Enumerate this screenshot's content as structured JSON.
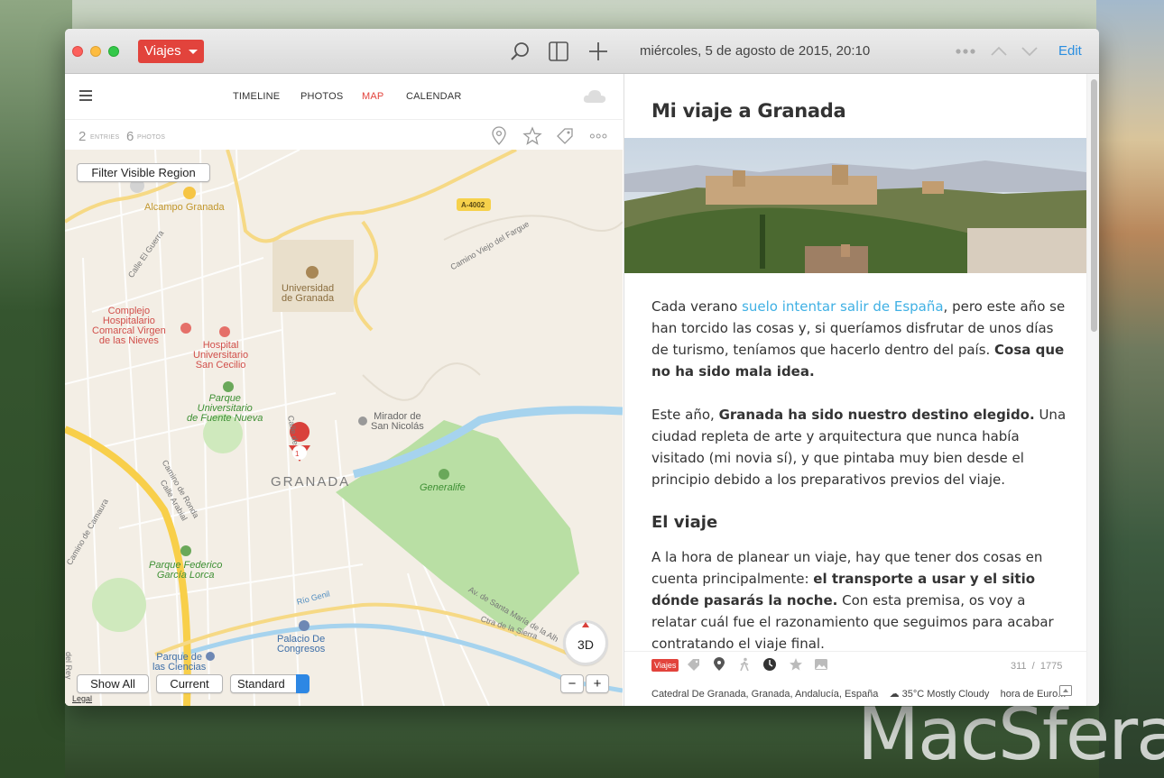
{
  "titlebar": {
    "journal": "Viajes",
    "date": "miércoles, 5 de agosto de 2015, 20:10",
    "edit": "Edit"
  },
  "nav": {
    "tabs": [
      "TIMELINE",
      "PHOTOS",
      "MAP",
      "CALENDAR"
    ],
    "active": "MAP"
  },
  "stats": {
    "entries_count": "2",
    "entries_label": "ENTRIES",
    "photos_count": "6",
    "photos_label": "PHOTOS"
  },
  "map": {
    "filter_button": "Filter Visible Region",
    "show_all": "Show All",
    "current": "Current",
    "map_type": "Standard",
    "compass": "3D",
    "zoom_out": "−",
    "zoom_in": "+",
    "legal": "Legal",
    "pin_count": "1",
    "city": "GRANADA",
    "road_badge": "A-4002",
    "labels": {
      "alcampo": "Alcampo Granada",
      "universidad": "Universidad\nde Granada",
      "complejo": "Complejo\nHospitalario\nComarcal Virgen\nde las Nieves",
      "hospital": "Hospital\nUniversitario\nSan Cecilio",
      "parque_univ": "Parque\nUniversitario\nde Fuente Nueva",
      "mirador": "Mirador de\nSan Nicolás",
      "generalife": "Generalife",
      "parque_federico": "Parque Federico\nGarcía Lorca",
      "palacio": "Palacio De\nCongresos",
      "parque_ciencias": "Parque de\nlas Ciencias"
    },
    "streets": {
      "el_guerra": "Calle El Guerra",
      "viejo_fargue": "Camino Viejo del Fargue",
      "ronda": "Camino de Ronda",
      "arabial": "Calle Arabial",
      "camaura": "Camino de Camaura",
      "callede": "Calle de",
      "rio_genil": "Río Genil",
      "santa_maria": "Av. de Santa María de la Alh",
      "sierra": "Ctra de la Sierra",
      "el_rey": "del Rey"
    }
  },
  "entry": {
    "title": "Mi viaje a Granada",
    "p1_a": "Cada verano ",
    "p1_link": "suelo intentar salir de España",
    "p1_b": ", pero este año se han torcido las cosas y, si queríamos disfrutar de unos días de turismo, teníamos que hacerlo dentro del país. ",
    "p1_bold": "Cosa que no ha sido mala idea.",
    "p2_a": "Este año, ",
    "p2_bold": "Granada ha sido nuestro destino elegido.",
    "p2_b": " Una ciudad repleta de arte y arquitectura que nunca había visitado (mi novia sí), y que pintaba muy bien desde el principio debido a los preparativos previos del viaje.",
    "h2": "El viaje",
    "p3_a": "A la hora de planear un viaje, hay que tener dos cosas en cuenta principalmente: ",
    "p3_bold": "el transporte a usar y el sitio dónde pasarás la noche.",
    "p3_b": " Con esta premisa, os voy a relatar cuál fue el razonamiento que seguimos para acabar contratando el viaje final."
  },
  "footer": {
    "tag": "Viajes",
    "words": "311",
    "separator": "/",
    "chars": "1775",
    "location": "Catedral De Granada, Granada, Andalucía, España",
    "weather": "35°C Mostly Cloudy",
    "time": "hora de Euro..."
  },
  "watermark": "MacSfera",
  "colors": {
    "accent": "#e2433c",
    "link": "#3fb0e4",
    "edit": "#2a8ee0"
  }
}
